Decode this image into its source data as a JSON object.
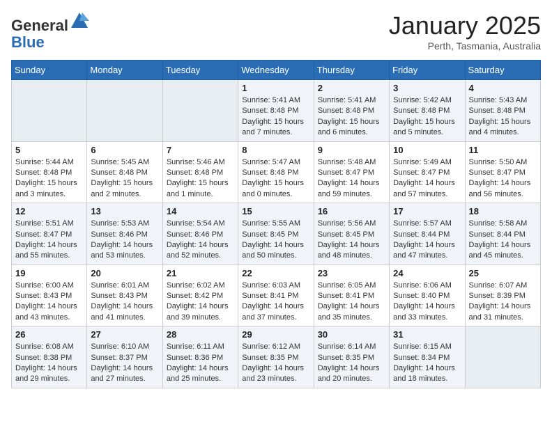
{
  "header": {
    "logo_general": "General",
    "logo_blue": "Blue",
    "month_title": "January 2025",
    "location": "Perth, Tasmania, Australia"
  },
  "days_of_week": [
    "Sunday",
    "Monday",
    "Tuesday",
    "Wednesday",
    "Thursday",
    "Friday",
    "Saturday"
  ],
  "weeks": [
    [
      {
        "day": "",
        "info": ""
      },
      {
        "day": "",
        "info": ""
      },
      {
        "day": "",
        "info": ""
      },
      {
        "day": "1",
        "info": "Sunrise: 5:41 AM\nSunset: 8:48 PM\nDaylight: 15 hours\nand 7 minutes."
      },
      {
        "day": "2",
        "info": "Sunrise: 5:41 AM\nSunset: 8:48 PM\nDaylight: 15 hours\nand 6 minutes."
      },
      {
        "day": "3",
        "info": "Sunrise: 5:42 AM\nSunset: 8:48 PM\nDaylight: 15 hours\nand 5 minutes."
      },
      {
        "day": "4",
        "info": "Sunrise: 5:43 AM\nSunset: 8:48 PM\nDaylight: 15 hours\nand 4 minutes."
      }
    ],
    [
      {
        "day": "5",
        "info": "Sunrise: 5:44 AM\nSunset: 8:48 PM\nDaylight: 15 hours\nand 3 minutes."
      },
      {
        "day": "6",
        "info": "Sunrise: 5:45 AM\nSunset: 8:48 PM\nDaylight: 15 hours\nand 2 minutes."
      },
      {
        "day": "7",
        "info": "Sunrise: 5:46 AM\nSunset: 8:48 PM\nDaylight: 15 hours\nand 1 minute."
      },
      {
        "day": "8",
        "info": "Sunrise: 5:47 AM\nSunset: 8:48 PM\nDaylight: 15 hours\nand 0 minutes."
      },
      {
        "day": "9",
        "info": "Sunrise: 5:48 AM\nSunset: 8:47 PM\nDaylight: 14 hours\nand 59 minutes."
      },
      {
        "day": "10",
        "info": "Sunrise: 5:49 AM\nSunset: 8:47 PM\nDaylight: 14 hours\nand 57 minutes."
      },
      {
        "day": "11",
        "info": "Sunrise: 5:50 AM\nSunset: 8:47 PM\nDaylight: 14 hours\nand 56 minutes."
      }
    ],
    [
      {
        "day": "12",
        "info": "Sunrise: 5:51 AM\nSunset: 8:47 PM\nDaylight: 14 hours\nand 55 minutes."
      },
      {
        "day": "13",
        "info": "Sunrise: 5:53 AM\nSunset: 8:46 PM\nDaylight: 14 hours\nand 53 minutes."
      },
      {
        "day": "14",
        "info": "Sunrise: 5:54 AM\nSunset: 8:46 PM\nDaylight: 14 hours\nand 52 minutes."
      },
      {
        "day": "15",
        "info": "Sunrise: 5:55 AM\nSunset: 8:45 PM\nDaylight: 14 hours\nand 50 minutes."
      },
      {
        "day": "16",
        "info": "Sunrise: 5:56 AM\nSunset: 8:45 PM\nDaylight: 14 hours\nand 48 minutes."
      },
      {
        "day": "17",
        "info": "Sunrise: 5:57 AM\nSunset: 8:44 PM\nDaylight: 14 hours\nand 47 minutes."
      },
      {
        "day": "18",
        "info": "Sunrise: 5:58 AM\nSunset: 8:44 PM\nDaylight: 14 hours\nand 45 minutes."
      }
    ],
    [
      {
        "day": "19",
        "info": "Sunrise: 6:00 AM\nSunset: 8:43 PM\nDaylight: 14 hours\nand 43 minutes."
      },
      {
        "day": "20",
        "info": "Sunrise: 6:01 AM\nSunset: 8:43 PM\nDaylight: 14 hours\nand 41 minutes."
      },
      {
        "day": "21",
        "info": "Sunrise: 6:02 AM\nSunset: 8:42 PM\nDaylight: 14 hours\nand 39 minutes."
      },
      {
        "day": "22",
        "info": "Sunrise: 6:03 AM\nSunset: 8:41 PM\nDaylight: 14 hours\nand 37 minutes."
      },
      {
        "day": "23",
        "info": "Sunrise: 6:05 AM\nSunset: 8:41 PM\nDaylight: 14 hours\nand 35 minutes."
      },
      {
        "day": "24",
        "info": "Sunrise: 6:06 AM\nSunset: 8:40 PM\nDaylight: 14 hours\nand 33 minutes."
      },
      {
        "day": "25",
        "info": "Sunrise: 6:07 AM\nSunset: 8:39 PM\nDaylight: 14 hours\nand 31 minutes."
      }
    ],
    [
      {
        "day": "26",
        "info": "Sunrise: 6:08 AM\nSunset: 8:38 PM\nDaylight: 14 hours\nand 29 minutes."
      },
      {
        "day": "27",
        "info": "Sunrise: 6:10 AM\nSunset: 8:37 PM\nDaylight: 14 hours\nand 27 minutes."
      },
      {
        "day": "28",
        "info": "Sunrise: 6:11 AM\nSunset: 8:36 PM\nDaylight: 14 hours\nand 25 minutes."
      },
      {
        "day": "29",
        "info": "Sunrise: 6:12 AM\nSunset: 8:35 PM\nDaylight: 14 hours\nand 23 minutes."
      },
      {
        "day": "30",
        "info": "Sunrise: 6:14 AM\nSunset: 8:35 PM\nDaylight: 14 hours\nand 20 minutes."
      },
      {
        "day": "31",
        "info": "Sunrise: 6:15 AM\nSunset: 8:34 PM\nDaylight: 14 hours\nand 18 minutes."
      },
      {
        "day": "",
        "info": ""
      }
    ]
  ]
}
